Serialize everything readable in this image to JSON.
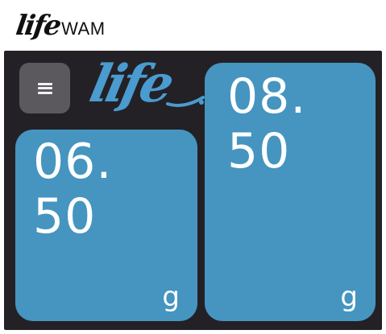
{
  "brand": {
    "script": "life",
    "suffix": "WAM"
  },
  "header": {
    "menu_icon": "hamburger-menu-icon",
    "logo_text": "life",
    "logo_color": "#4a9bd0"
  },
  "colors": {
    "device_background": "#232125",
    "tile_background": "#4595c0",
    "menu_button_background": "#5b595e",
    "text": "#ffffff"
  },
  "tiles": [
    {
      "value_line1": "06.",
      "value_line2": "50",
      "unit": "g"
    },
    {
      "value_line1": "08.",
      "value_line2": "50",
      "unit": "g"
    }
  ]
}
